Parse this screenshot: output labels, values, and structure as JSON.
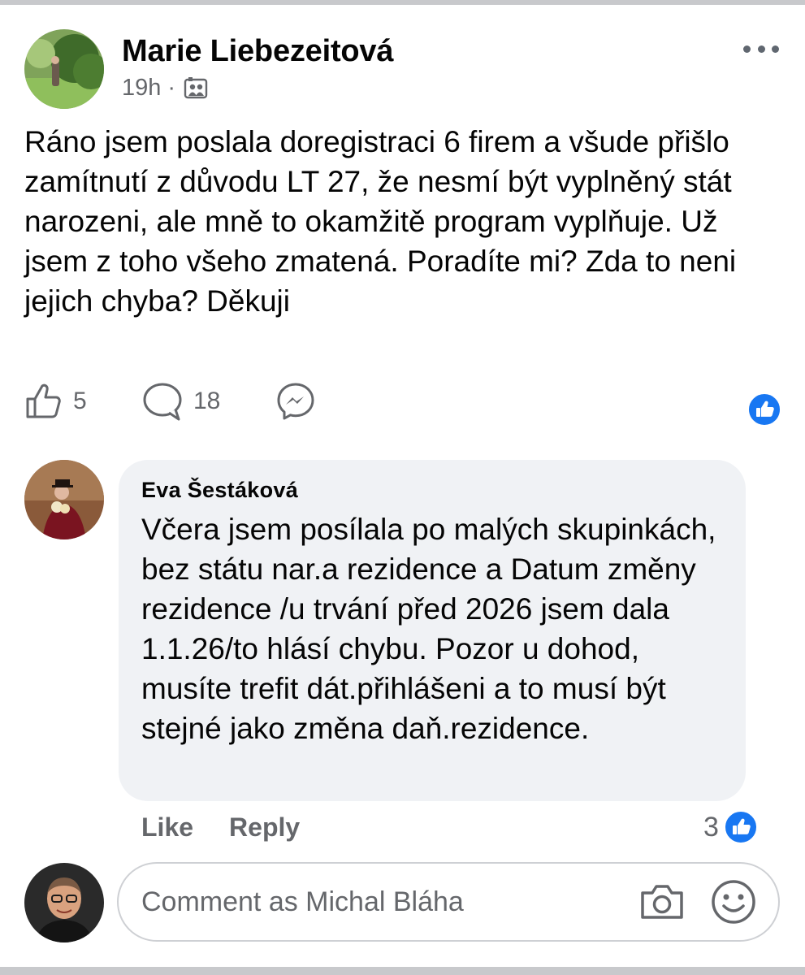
{
  "post": {
    "author": "Marie Liebezeitová",
    "time": "19h",
    "separator": "·",
    "audience_icon": "friends-audience-icon",
    "text": "Ráno jsem poslala  doregistraci 6 firem a všude přišlo zamítnutí z důvodu LT 27,  že nesmí být vyplněný stát narozeni, ale mně to okamžitě program vyplňuje.  Už jsem z toho všeho zmatená.  Poradíte mi? Zda to neni jejich chyba? Děkuji",
    "like_count": "5",
    "comment_count": "18"
  },
  "comment": {
    "author": "Eva Šestáková",
    "text": "Včera jsem posílala po malých skupinkách,  bez státu nar.a rezidence a Datum změny rezidence /u trvání před 2026 jsem dala 1.1.26/to hlásí chybu. Pozor u dohod, musíte trefit dát.přihlášeni a to musí být stejné jako změna daň.rezidence.",
    "like_label": "Like",
    "reply_label": "Reply",
    "reaction_count": "3"
  },
  "composer": {
    "placeholder": "Comment as Michal Bláha"
  },
  "colors": {
    "facebook_blue": "#1877f2",
    "secondary_text": "#65676b",
    "bubble_bg": "#f0f2f5"
  }
}
